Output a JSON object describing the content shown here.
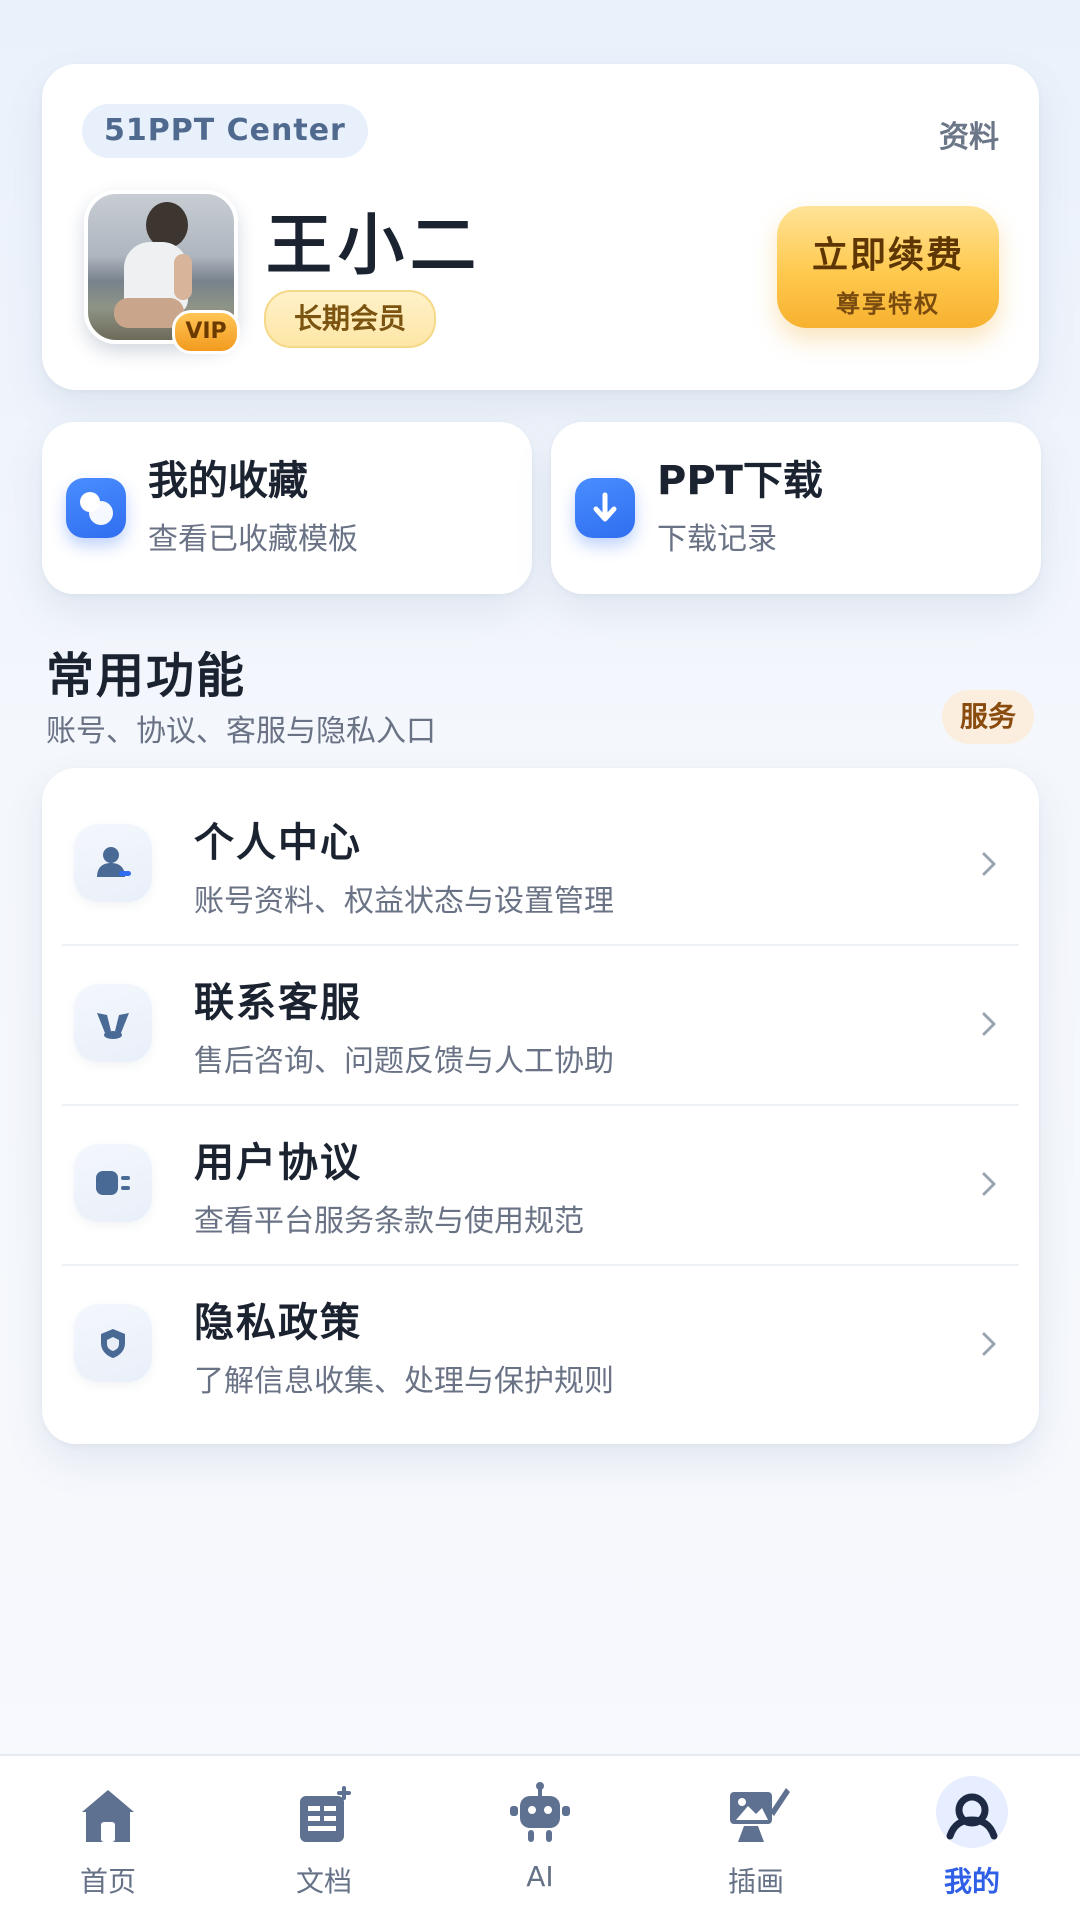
{
  "profile": {
    "brand": "51PPT Center",
    "profile_link": "资料",
    "name": "王小二",
    "vip_badge": "VIP",
    "member_level": "长期会员",
    "renew_label": "立即续费",
    "renew_sub": "尊享特权"
  },
  "quick_actions": [
    {
      "title": "我的收藏",
      "subtitle": "查看已收藏模板",
      "icon": "favorites-icon"
    },
    {
      "title": "PPT下载",
      "subtitle": "下载记录",
      "icon": "download-icon"
    }
  ],
  "section": {
    "title": "常用功能",
    "subtitle": "账号、协议、客服与隐私入口",
    "tag": "服务"
  },
  "menu": [
    {
      "title": "个人中心",
      "subtitle": "账号资料、权益状态与设置管理",
      "icon": "user-icon"
    },
    {
      "title": "联系客服",
      "subtitle": "售后咨询、问题反馈与人工协助",
      "icon": "customer-service-icon"
    },
    {
      "title": "用户协议",
      "subtitle": "查看平台服务条款与使用规范",
      "icon": "agreement-icon"
    },
    {
      "title": "隐私政策",
      "subtitle": "了解信息收集、处理与保护规则",
      "icon": "shield-icon"
    }
  ],
  "bottom_nav": [
    {
      "label": "首页",
      "icon": "home-icon",
      "active": false
    },
    {
      "label": "文档",
      "icon": "document-icon",
      "active": false
    },
    {
      "label": "AI",
      "icon": "robot-icon",
      "active": false
    },
    {
      "label": "插画",
      "icon": "illustration-icon",
      "active": false
    },
    {
      "label": "我的",
      "icon": "profile-icon",
      "active": true
    }
  ],
  "colors": {
    "accent": "#2f6ef0",
    "nav_active": "#2e5fe6",
    "gold": "#f7b12f",
    "text_primary": "#1b2230",
    "text_secondary": "#6a7385"
  }
}
